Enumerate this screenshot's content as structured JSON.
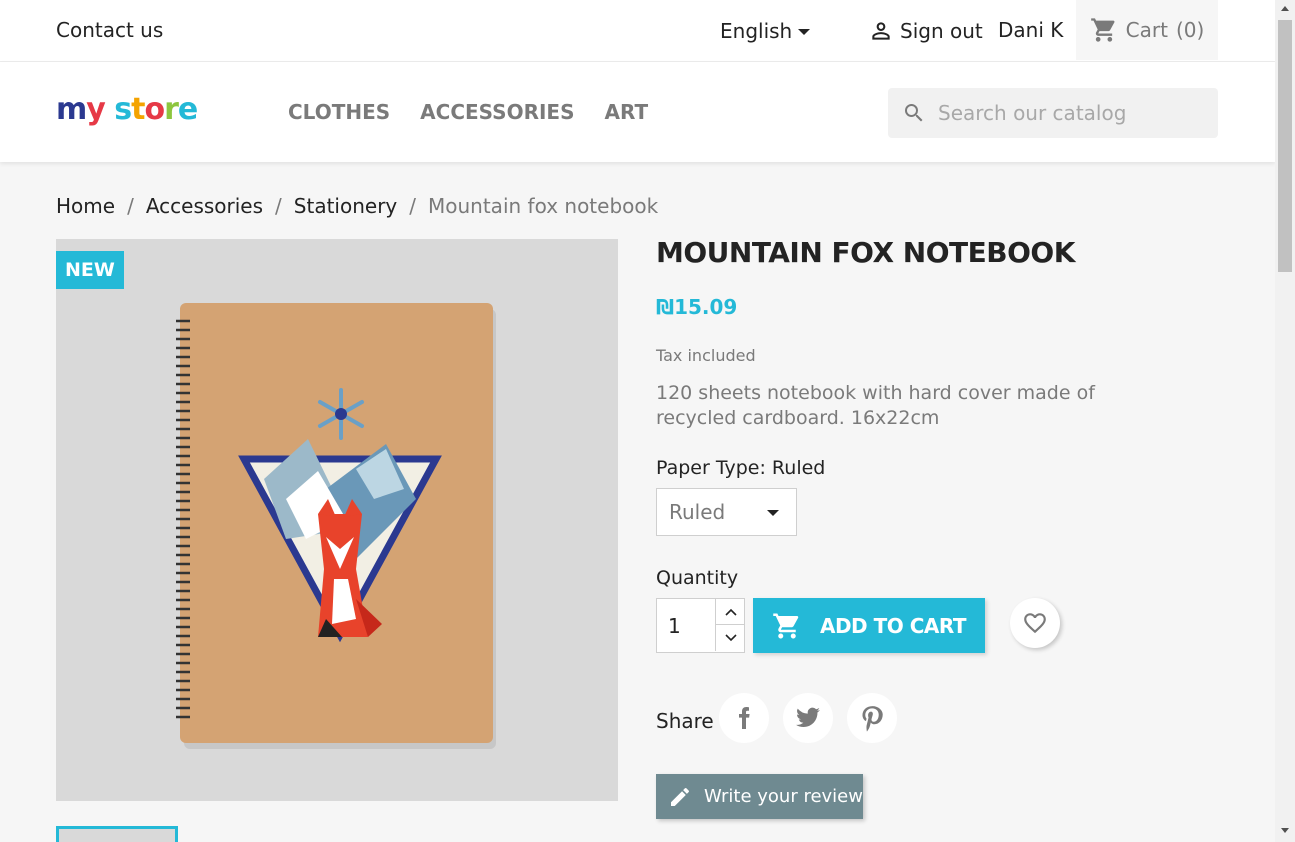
{
  "topbar": {
    "contact_label": "Contact us",
    "language_label": "English",
    "signout_label": "Sign out",
    "username": "Dani K",
    "cart_label": "Cart",
    "cart_count": "(0)"
  },
  "header": {
    "logo_text": "my store",
    "nav": [
      {
        "label": "CLOTHES"
      },
      {
        "label": "ACCESSORIES"
      },
      {
        "label": "ART"
      }
    ],
    "search_placeholder": "Search our catalog"
  },
  "breadcrumb": [
    {
      "label": "Home"
    },
    {
      "label": "Accessories"
    },
    {
      "label": "Stationery"
    },
    {
      "label": "Mountain fox notebook"
    }
  ],
  "product": {
    "badge": "NEW",
    "title": "MOUNTAIN FOX NOTEBOOK",
    "price": "₪15.09",
    "tax_label": "Tax included",
    "description": "120 sheets notebook with hard cover made of recycled cardboard. 16x22cm",
    "variant_label": "Paper Type: Ruled",
    "variant_value": "Ruled",
    "quantity_label": "Quantity",
    "quantity_value": "1",
    "add_to_cart_label": "ADD TO CART",
    "share_label": "Share",
    "review_label": "Write your review"
  },
  "colors": {
    "accent": "#24b9d7",
    "background": "#f6f6f6",
    "text": "#232323",
    "muted": "#7a7a7a"
  },
  "icons": {
    "account": "person-icon",
    "cart": "shopping-cart-icon",
    "search": "search-icon",
    "wishlist": "heart-icon",
    "facebook": "facebook-icon",
    "twitter": "twitter-icon",
    "pinterest": "pinterest-icon",
    "review": "pencil-icon"
  }
}
